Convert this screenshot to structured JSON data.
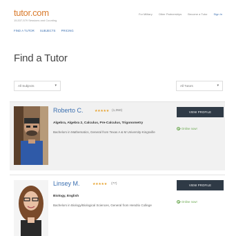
{
  "header": {
    "logo": "tutor.com",
    "tagline": "15,537,579 Sessions and Counting",
    "topnav": [
      "For Military",
      "Other Partnerships",
      "Become a Tutor",
      "Sign In"
    ],
    "subnav": [
      "FIND A TUTOR",
      "SUBJECTS",
      "PRICING"
    ]
  },
  "page_title": "Find a Tutor",
  "filters": {
    "subject": "All Subjects",
    "tutor": "All Tutors"
  },
  "tutors": [
    {
      "name": "Roberto C.",
      "stars": "★★★★★",
      "rating_count": "(1,050)",
      "subjects": "Algebra, Algebra 2, Calculus, Pre-Calculus, Trigonometry",
      "education": "Bachelors in Mathematics, General from Texas A & M University-Kingsville",
      "button": "VIEW PROFILE",
      "status": "Online now!"
    },
    {
      "name": "Linsey M.",
      "stars": "★★★★★",
      "rating_count": "(77)",
      "subjects": "Biology, English",
      "education": "Bachelors in Biology/Biological Sciences, General from Hendrix College",
      "button": "VIEW PROFILE",
      "status": "Online now!"
    }
  ],
  "colors": {
    "brand_orange": "#d97a2b",
    "link_blue": "#3b6fb0",
    "button_dark": "#2f3a46",
    "online_green": "#6aa84f",
    "star_gold": "#e6a02a"
  }
}
